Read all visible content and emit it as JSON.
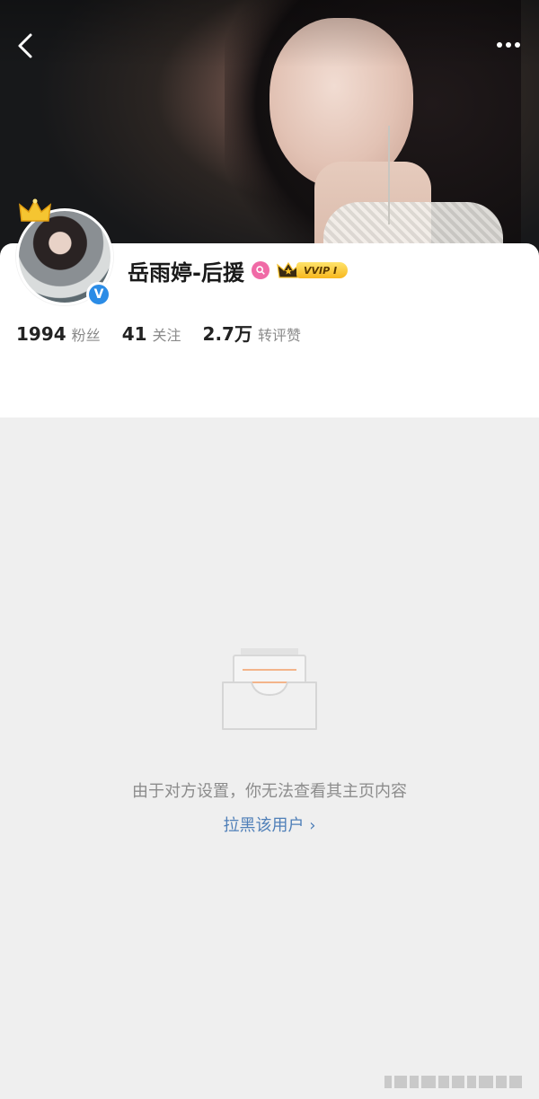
{
  "profile": {
    "name": "岳雨婷-后援",
    "vip_label": "VVIP I",
    "verified_mark": "V",
    "stats": [
      {
        "value": "1994",
        "label": "粉丝"
      },
      {
        "value": "41",
        "label": "关注"
      },
      {
        "value": "2.7万",
        "label": "转评赞"
      }
    ]
  },
  "empty_state": {
    "message": "由于对方设置，你无法查看其主页内容",
    "block_link": "拉黑该用户 ›"
  },
  "colors": {
    "verified_blue": "#2b8ce6",
    "link_blue": "#4f7fb8",
    "gender_pink": "#f06aa6",
    "vip_gold": "#f7b71e"
  },
  "icons": [
    "back-chevron-icon",
    "more-dots-icon",
    "crown-icon",
    "verified-icon",
    "female-icon",
    "vip-crown-icon",
    "empty-inbox-icon"
  ]
}
